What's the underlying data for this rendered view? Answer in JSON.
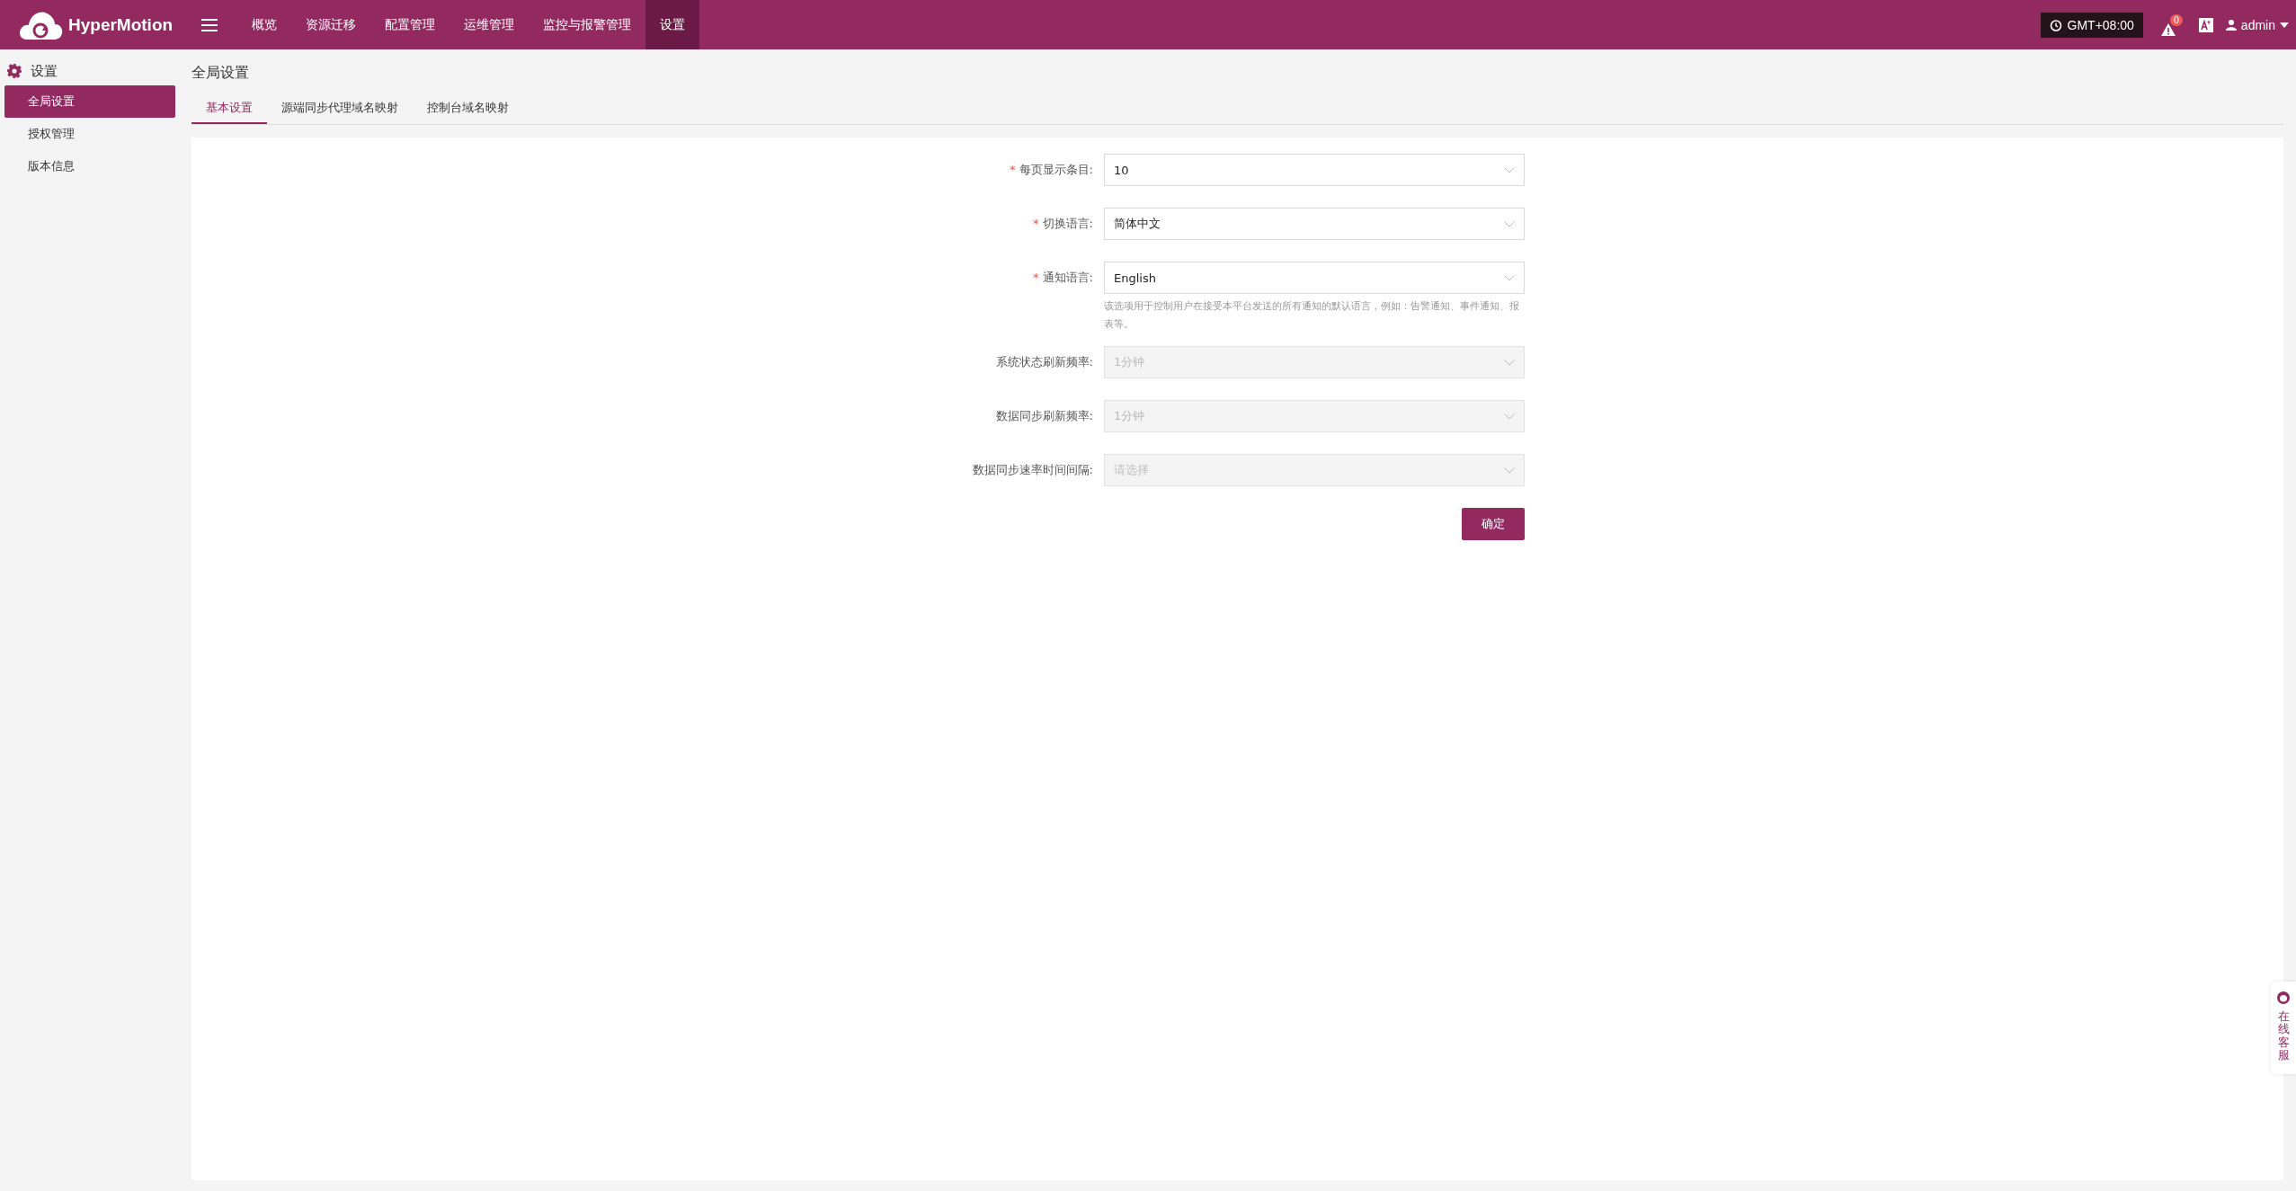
{
  "header": {
    "brand": "HyperMotion",
    "nav": [
      {
        "label": "概览",
        "selected": false
      },
      {
        "label": "资源迁移",
        "selected": false
      },
      {
        "label": "配置管理",
        "selected": false
      },
      {
        "label": "运维管理",
        "selected": false
      },
      {
        "label": "监控与报警管理",
        "selected": false
      },
      {
        "label": "设置",
        "selected": true
      }
    ],
    "timezone": "GMT+08:00",
    "alert_count": "0",
    "user": "admin"
  },
  "sidebar": {
    "title": "设置",
    "items": [
      {
        "label": "全局设置",
        "selected": true
      },
      {
        "label": "授权管理",
        "selected": false
      },
      {
        "label": "版本信息",
        "selected": false
      }
    ]
  },
  "page_title": "全局设置",
  "tabs": [
    {
      "label": "基本设置",
      "selected": true
    },
    {
      "label": "源端同步代理域名映射",
      "selected": false
    },
    {
      "label": "控制台域名映射",
      "selected": false
    }
  ],
  "form": {
    "fields": [
      {
        "label": "每页显示条目:",
        "required_mark": "*",
        "value": "10",
        "disabled": false
      },
      {
        "label": "切换语言:",
        "required_mark": "*",
        "value": "简体中文",
        "disabled": false
      },
      {
        "label": "通知语言:",
        "required_mark": "*",
        "value": "English",
        "disabled": false,
        "hint": "该选项用于控制用户在接受本平台发送的所有通知的默认语言，例如：告警通知、事件通知、报表等。"
      },
      {
        "label": "系统状态刷新频率:",
        "value": "1分钟",
        "disabled": true
      },
      {
        "label": "数据同步刷新频率:",
        "value": "1分钟",
        "disabled": true
      },
      {
        "label": "数据同步速率时间间隔:",
        "placeholder": "请选择",
        "disabled": true
      }
    ],
    "submit": "确定"
  },
  "support_widget": {
    "label": "在线客服"
  }
}
